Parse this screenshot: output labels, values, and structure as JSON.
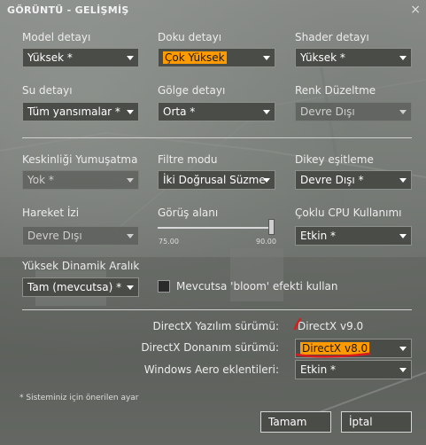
{
  "window": {
    "title": "GÖRÜNTÜ - GELİŞMİŞ",
    "close_glyph": "×"
  },
  "section1": {
    "model": {
      "label": "Model detayı",
      "value": "Yüksek *"
    },
    "texture": {
      "label": "Doku detayı",
      "value": "Çok Yüksek"
    },
    "shader": {
      "label": "Shader detayı",
      "value": "Yüksek *"
    },
    "water": {
      "label": "Su detayı",
      "value": "Tüm yansımalar *"
    },
    "shadow": {
      "label": "Gölge detayı",
      "value": "Orta *"
    },
    "color_correction": {
      "label": "Renk Düzeltme",
      "value": "Devre Dışı"
    }
  },
  "section2": {
    "antialiasing": {
      "label": "Keskinliği Yumuşatma",
      "value": "Yok *"
    },
    "filtering": {
      "label": "Filtre modu",
      "value": "İki Doğrusal Süzme"
    },
    "vsync": {
      "label": "Dikey eşitleme",
      "value": "Devre Dışı *"
    },
    "motion_blur": {
      "label": "Hareket İzi",
      "value": "Devre Dışı"
    },
    "fov": {
      "label": "Görüş alanı",
      "min_label": "75.00",
      "max_label": "90.00",
      "value_fraction": 1.0
    },
    "multicore": {
      "label": "Çoklu CPU Kullanımı",
      "value": "Etkin *"
    },
    "hdr": {
      "label": "Yüksek Dinamik Aralık",
      "value": "Tam (mevcutsa) *"
    },
    "bloom": {
      "label": "Mevcutsa 'bloom' efekti kullan",
      "checked": false
    }
  },
  "section3": {
    "dx_software": {
      "label": "DirectX Yazılım sürümü:",
      "value": "DirectX v9.0"
    },
    "dx_hardware": {
      "label": "DirectX Donanım sürümü:",
      "value": "DirectX v8.0"
    },
    "aero": {
      "label": "Windows Aero eklentileri:",
      "value": "Etkin *"
    }
  },
  "footnote": "* Sisteminiz için önerilen ayar",
  "buttons": {
    "ok": "Tamam",
    "cancel": "İptal"
  },
  "colors": {
    "highlight": "#ff9a00",
    "annotation": "#d81c1c"
  }
}
